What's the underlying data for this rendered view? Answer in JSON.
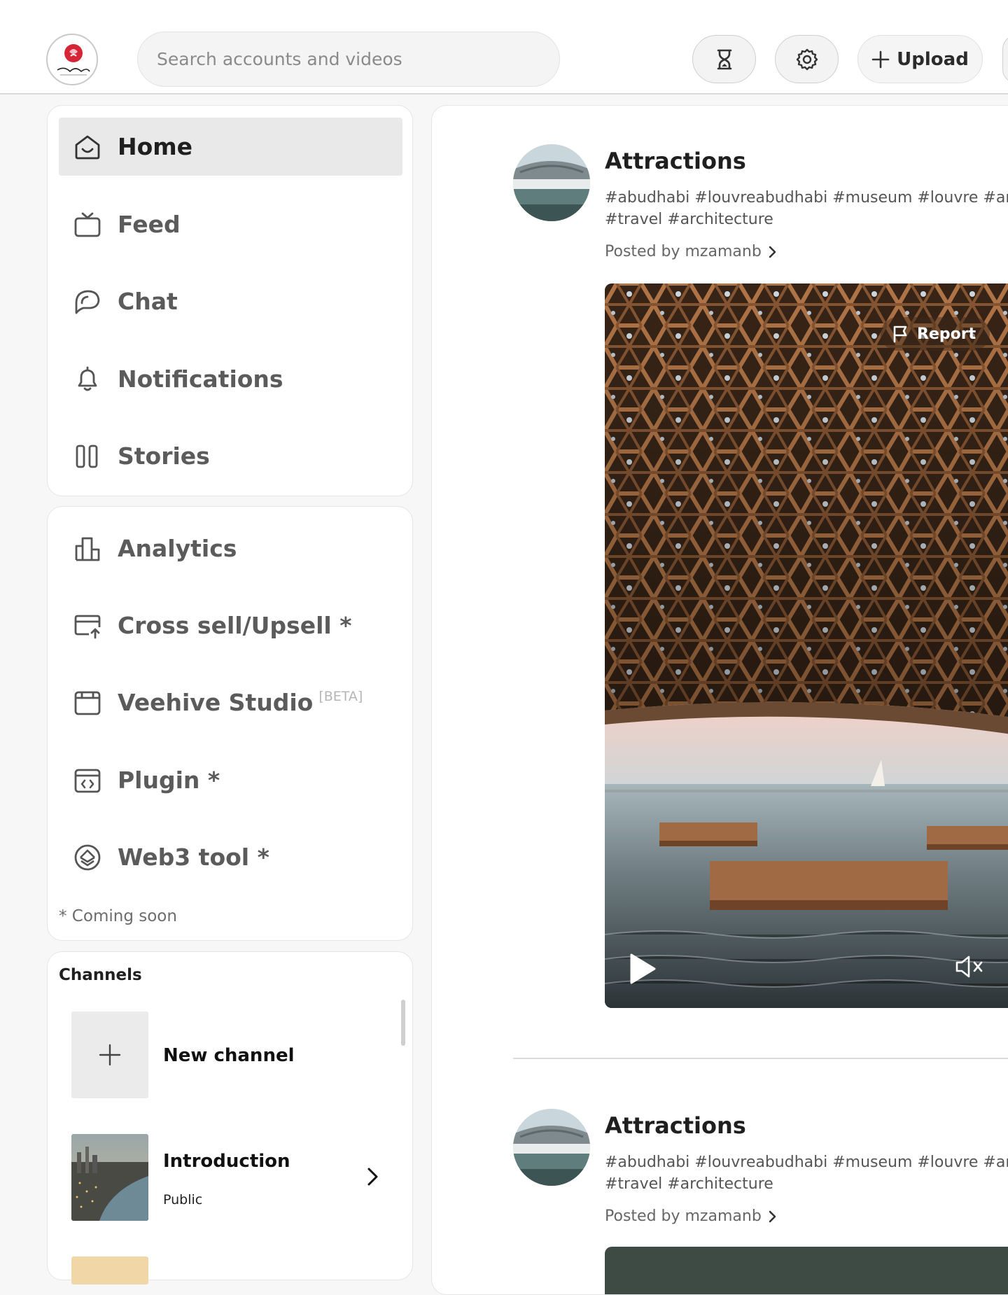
{
  "header": {
    "logo_alt": "Abu Dhabi",
    "search": {
      "placeholder": "Search accounts and videos",
      "value": ""
    },
    "upload_label": "Upload"
  },
  "sidebar": {
    "primary_nav": [
      {
        "label": "Home",
        "icon": "home-icon",
        "active": true
      },
      {
        "label": "Feed",
        "icon": "tv-icon",
        "active": false
      },
      {
        "label": "Chat",
        "icon": "chat-icon",
        "active": false
      },
      {
        "label": "Notifications",
        "icon": "bell-icon",
        "active": false
      },
      {
        "label": "Stories",
        "icon": "stories-icon",
        "active": false
      }
    ],
    "tools_nav": [
      {
        "label": "Analytics",
        "icon": "analytics-icon"
      },
      {
        "label": "Cross sell/Upsell *",
        "icon": "cross-sell-icon"
      },
      {
        "label": "Veehive Studio",
        "badge": "[BETA]",
        "icon": "studio-icon"
      },
      {
        "label": "Plugin *",
        "icon": "plugin-icon"
      },
      {
        "label": "Web3 tool *",
        "icon": "web3-icon"
      }
    ],
    "coming_soon_note": "* Coming soon",
    "channels": {
      "title": "Channels",
      "new_label": "New channel",
      "items": [
        {
          "name": "Introduction",
          "visibility": "Public"
        }
      ]
    }
  },
  "feed": {
    "posts": [
      {
        "title": "Attractions",
        "tags": "#abudhabi #louvreabudhabi  #museum #louvre #art #travel #architecture",
        "posted_by": "Posted by mzamanb",
        "report_label": "Report"
      },
      {
        "title": "Attractions",
        "tags": "#abudhabi #louvreabudhabi  #museum #louvre #art #travel #architecture",
        "posted_by": "Posted by mzamanb"
      }
    ]
  },
  "colors": {
    "active_nav_bg": "#e9e9e9",
    "logo_red": "#d62536",
    "text_muted": "#5b5b5b"
  }
}
